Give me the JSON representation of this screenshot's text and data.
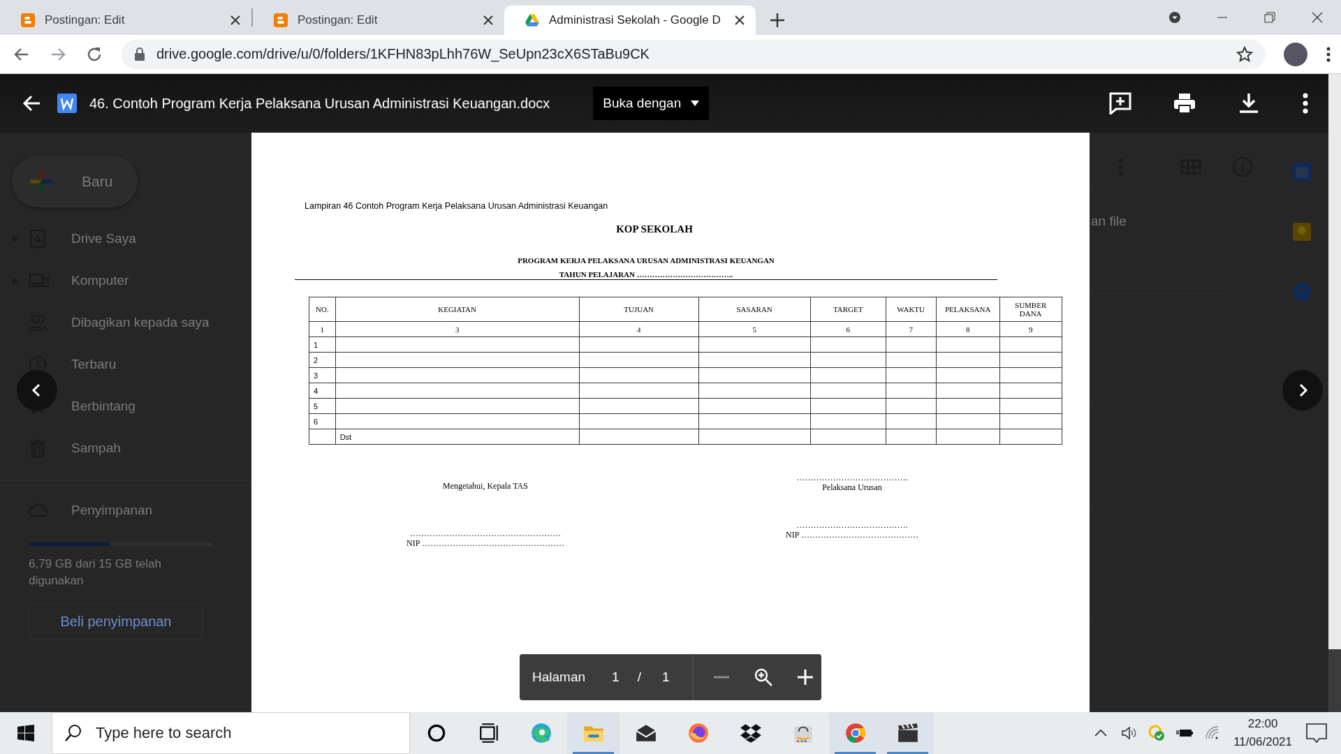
{
  "browser": {
    "tabs": [
      {
        "title": "Postingan: Edit",
        "kind": "blogger",
        "selected": false
      },
      {
        "title": "Postingan: Edit",
        "kind": "blogger",
        "selected": false
      },
      {
        "title": "Administrasi Sekolah - Google D",
        "kind": "drive",
        "selected": true
      }
    ],
    "url": "drive.google.com/drive/u/0/folders/1KFHN83pLhh76W_SeUpn23cX6STaBu9CK"
  },
  "viewer": {
    "file_name": "46. Contoh Program Kerja Pelaksana Urusan Administrasi Keuangan.docx",
    "open_with": "Buka dengan"
  },
  "drive_background": {
    "new_button": "Baru",
    "nav": [
      {
        "label": "Drive Saya",
        "kind": "drive",
        "expandable": true
      },
      {
        "label": "Komputer",
        "kind": "computer",
        "expandable": true
      },
      {
        "label": "Dibagikan kepada saya",
        "kind": "shared",
        "expandable": false
      },
      {
        "label": "Terbaru",
        "kind": "recent",
        "expandable": false
      },
      {
        "label": "Berbintang",
        "kind": "star",
        "expandable": false
      },
      {
        "label": "Sampah",
        "kind": "trash",
        "expandable": false
      }
    ],
    "storage_label": "Penyimpanan",
    "storage": {
      "level": 0.44
    },
    "storage_usage": "6,79 GB dari 15 GB telah digunakan",
    "buy_button": "Beli penyimpanan",
    "partial_column_text": "an file"
  },
  "document": {
    "caption": "Lampiran 46 Contoh Program Kerja Pelaksana Urusan Administrasi Keuangan",
    "letterhead": "KOP SEKOLAH",
    "title": "PROGRAM KERJA PELAKSANA URUSAN ADMINISTRASI KEUANGAN",
    "year_line": "TAHUN  PELAJARAN ………………………………..",
    "table": {
      "columns": [
        "NO.",
        "KEGIATAN",
        "TUJUAN",
        "SASARAN",
        "TARGET",
        "WAKTU",
        "PELAKSANA",
        "SUMBER DANA"
      ],
      "number_row": [
        "1",
        "3",
        "4",
        "5",
        "6",
        "7",
        "8",
        "9"
      ],
      "rows": [
        {
          "no": "1"
        },
        {
          "no": "2"
        },
        {
          "no": "3"
        },
        {
          "no": "4"
        },
        {
          "no": "5"
        },
        {
          "no": "6"
        },
        {
          "kegiatan": "Dst"
        }
      ]
    },
    "signatures": [
      {
        "lines": [
          "Mengetahui, Kepala TAS"
        ],
        "name_line": "………………………………………………",
        "nip": "NIP ……………………………………………"
      },
      {
        "lines": [
          "………………………………….",
          "Pelaksana Urusan"
        ],
        "name_line": "………………………………….",
        "nip": "NIP ……………………………………"
      }
    ]
  },
  "page_controls": {
    "label": "Halaman",
    "current": "1",
    "separator": "/",
    "total": "1",
    "zoom_out_disabled": true
  },
  "taskbar": {
    "search_placeholder": "Type here to search",
    "apps": [
      {
        "kind": "cortana",
        "running": false
      },
      {
        "kind": "taskview",
        "running": false
      },
      {
        "kind": "edge",
        "running": false
      },
      {
        "kind": "explorer",
        "running": true
      },
      {
        "kind": "mail",
        "running": false
      },
      {
        "kind": "firefox",
        "running": false
      },
      {
        "kind": "dropbox",
        "running": false
      },
      {
        "kind": "amazon",
        "running": false
      },
      {
        "kind": "chrome",
        "running": true
      },
      {
        "kind": "clapper",
        "running": true
      }
    ],
    "time": "22:00",
    "date": "11/06/2021"
  }
}
